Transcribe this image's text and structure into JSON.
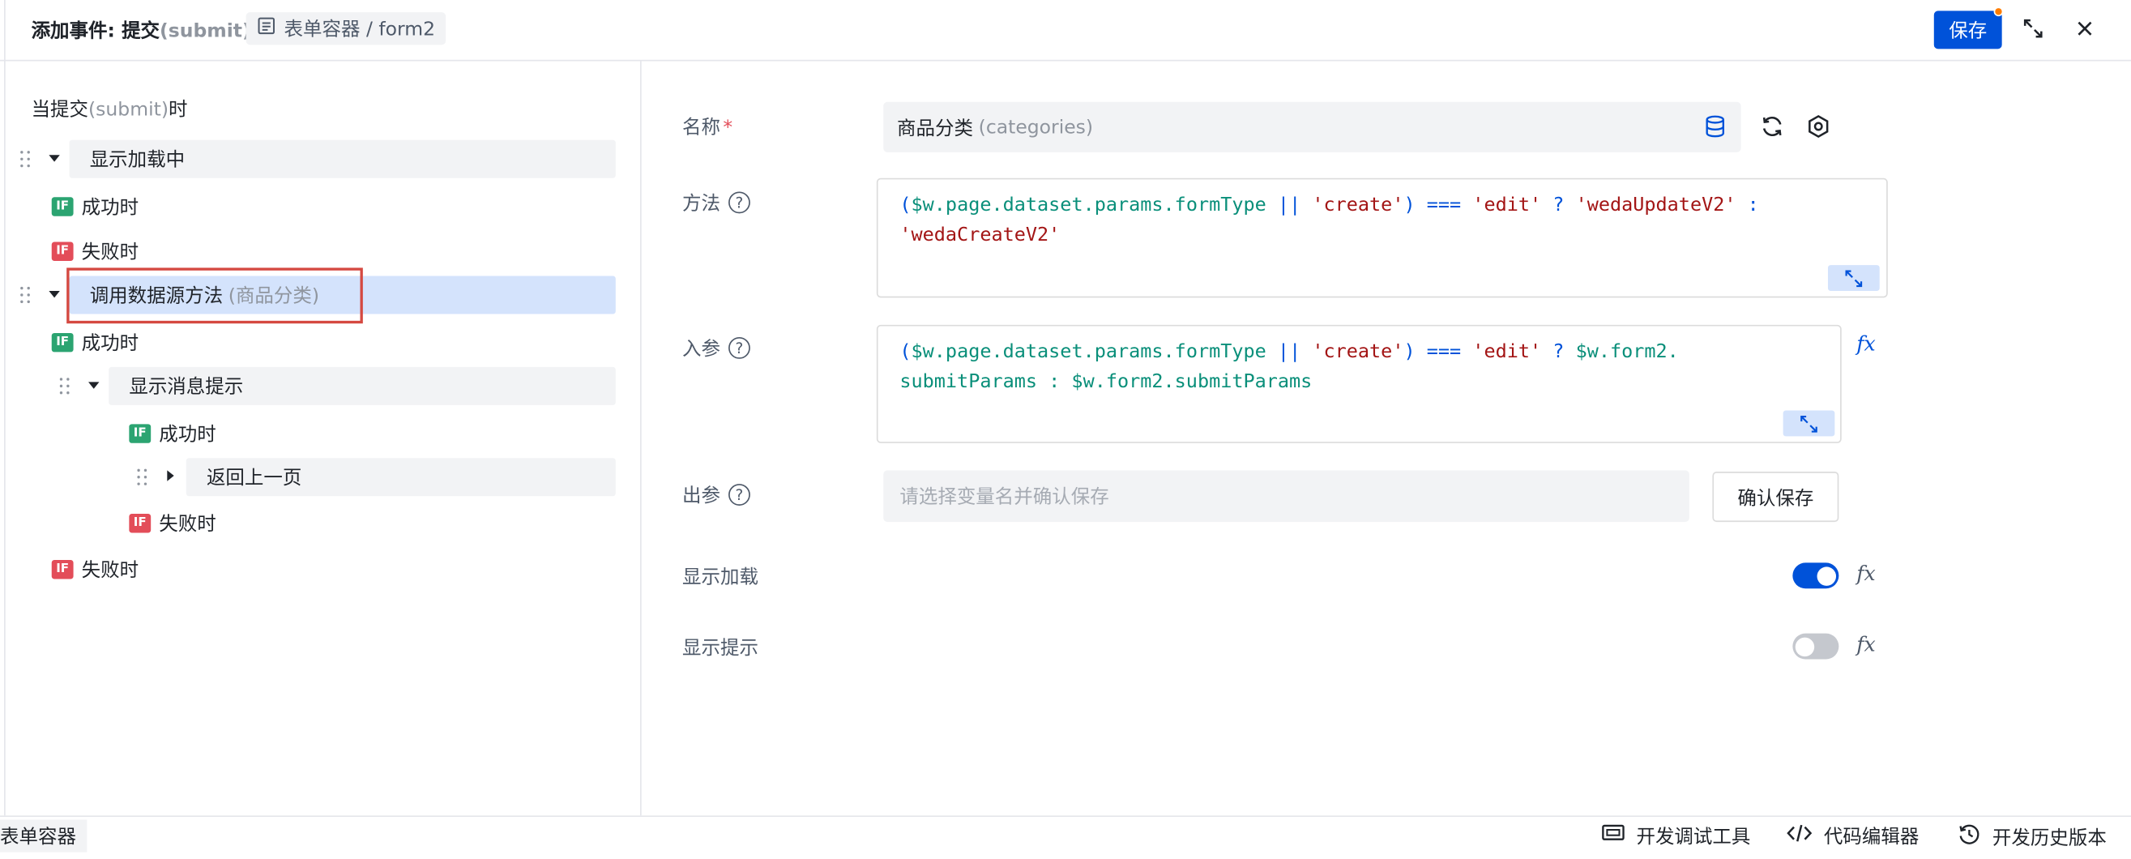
{
  "header": {
    "title_prefix": "添加事件: 提交",
    "title_event": "(submit)",
    "breadcrumb": "表单容器 / form2",
    "save_label": "保存",
    "icons": [
      "form-icon",
      "fullscreen-icon",
      "close-icon"
    ]
  },
  "tree": {
    "trigger_prefix": "当提交",
    "trigger_event": "(submit)",
    "trigger_suffix": "时",
    "node_loading": "显示加载中",
    "branch_ok_1": "成功时",
    "branch_fail_1": "失败时",
    "node_call": "调用数据源方法",
    "node_call_sub": "(商品分类)",
    "branch_ok_2": "成功时",
    "node_message": "显示消息提示",
    "branch_ok_3": "成功时",
    "node_back": "返回上一页",
    "branch_fail_3": "失败时",
    "branch_fail_2": "失败时",
    "badge_text": "IF"
  },
  "form": {
    "name_label": "名称",
    "required_mark": "*",
    "name_value": "商品分类",
    "name_sub": "(categories)",
    "method_label": "方法",
    "method_code": {
      "t1": "(",
      "t2": "$w.page.dataset.params.formType",
      "t3": " || ",
      "t4": "'create'",
      "t5": ") === ",
      "t6": "'edit'",
      "t7": " ? ",
      "t8": "'wedaUpdateV2'",
      "t9": " :",
      "t10": "'wedaCreateV2'"
    },
    "params_label": "入参",
    "params_code": {
      "t1": "(",
      "t2": "$w.page.dataset.params.formType",
      "t3": " || ",
      "t4": "'create'",
      "t5": ") === ",
      "t6": "'edit'",
      "t7": " ? ",
      "t8": "$w.form2.",
      "t9": "submitParams : $w.form2.submitParams"
    },
    "output_label": "出参",
    "output_placeholder": "请选择变量名并确认保存",
    "confirm_label": "确认保存",
    "show_loading_label": "显示加载",
    "show_loading_on": true,
    "show_tip_label": "显示提示",
    "show_tip_on": false,
    "fx_text": "fx",
    "help_text": "?"
  },
  "footer": {
    "tab_label": "表单容器",
    "debug_label": "开发调试工具",
    "code_editor_label": "代码编辑器",
    "history_label": "开发历史版本"
  },
  "colors": {
    "primary": "#0052d9",
    "success": "#2ba471",
    "error": "#e34d59",
    "notification_dot": "#ff7d00"
  }
}
